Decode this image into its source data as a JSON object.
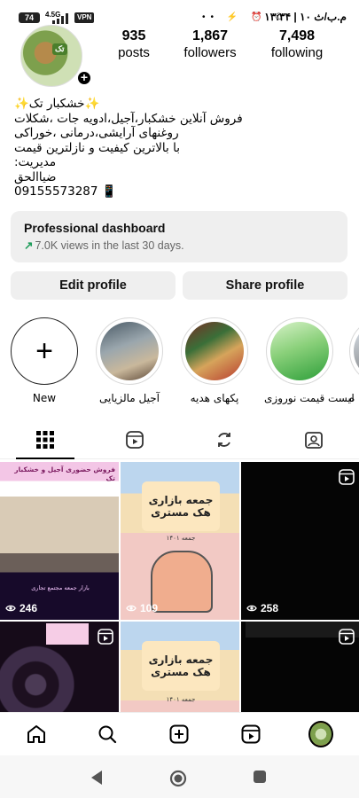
{
  "status_bar": {
    "battery": "74",
    "network": "4.5G",
    "vpn": "VPN",
    "time": "۱۳:۳۴ | ۱۰ م.ب/ث"
  },
  "profile": {
    "avatar_label": "تک",
    "stats": [
      {
        "value": "935",
        "label": "posts"
      },
      {
        "value": "1,867",
        "label": "followers"
      },
      {
        "value": "7,498",
        "label": "following"
      }
    ],
    "bio_lines": [
      "✨خشکبار تک✨",
      "فروش آنلاین خشکبار،آجیل،ادویه جات ،شکلات",
      "روغنهای آرایشی،درمانی ،خوراکی",
      "با بالاترین کیفیت و نازلترین قیمت",
      "مدیریت:",
      "ضیاالحق",
      "09155573287 📱"
    ]
  },
  "dashboard": {
    "title": "Professional dashboard",
    "subtitle": "7.0K views in the last 30 days."
  },
  "buttons": {
    "edit": "Edit profile",
    "share": "Share profile"
  },
  "highlights": [
    {
      "label": "New"
    },
    {
      "label": "آجیل مالزیایی"
    },
    {
      "label": "پکهای هدیه"
    },
    {
      "label": "لیست قیمت نوروزی"
    },
    {
      "label": "ه"
    }
  ],
  "grid": {
    "posts": [
      {
        "views": "246",
        "banner": "فروش حضوری آجیل و خشکبار تک",
        "footer": "بازار جمعه مجتمع تجاری"
      },
      {
        "views": "109",
        "poster": "جمعه بازاری هک مستری",
        "caption": "جمعه ۱۴۰۱"
      },
      {
        "views": "258"
      },
      {
        "views": ""
      },
      {
        "views": "",
        "poster": "جمعه بازاری هک مستری",
        "caption": "جمعه ۱۴۰۱"
      },
      {
        "views": ""
      }
    ]
  }
}
